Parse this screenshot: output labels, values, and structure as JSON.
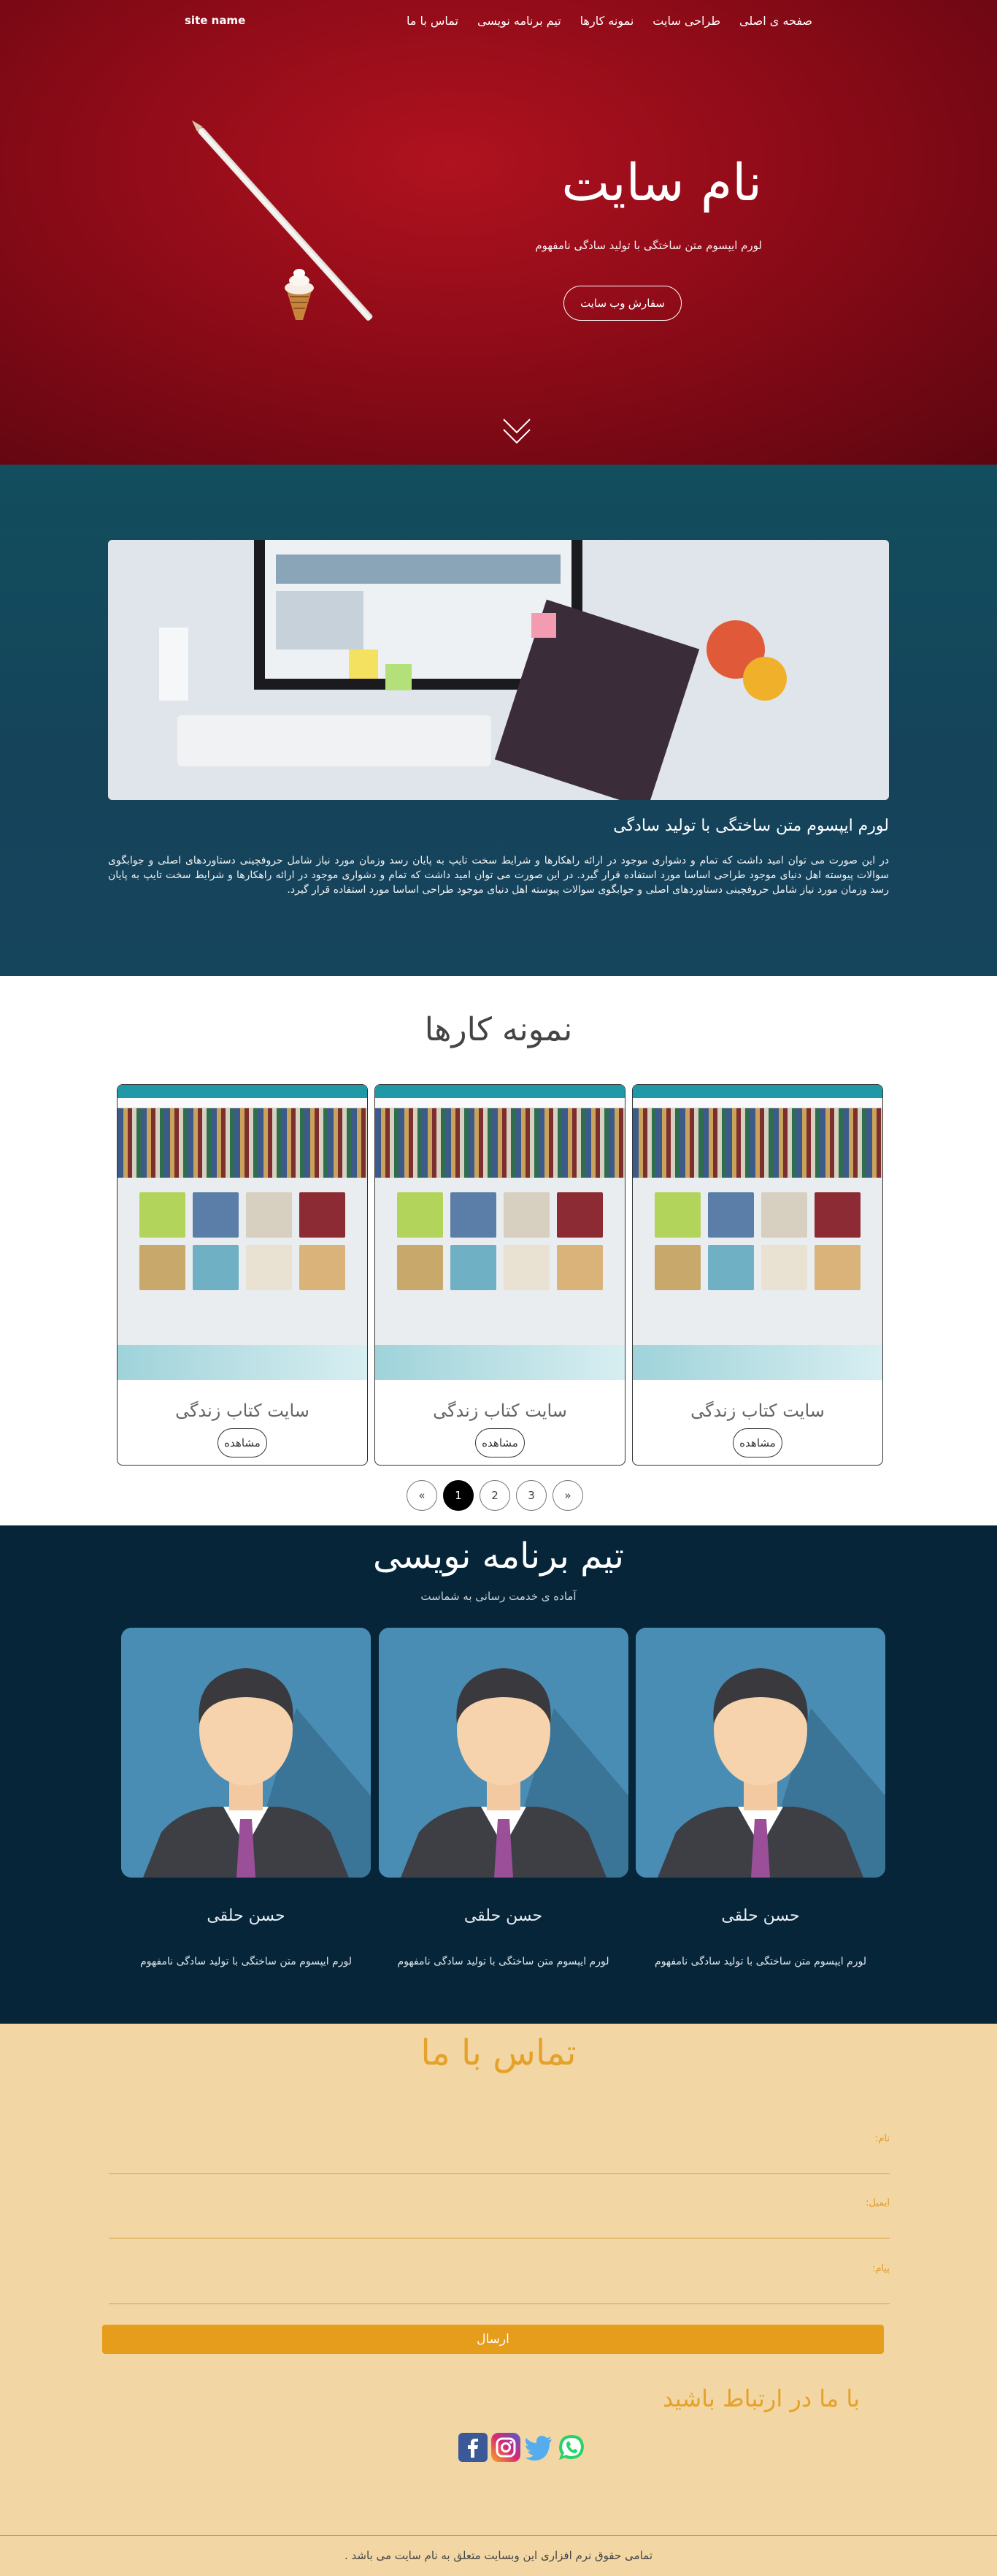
{
  "nav": {
    "brand": "site name",
    "items": [
      {
        "label": "صفحه ی اصلی"
      },
      {
        "label": "طراحی سایت"
      },
      {
        "label": "نمونه کارها"
      },
      {
        "label": "تیم برنامه نویسی"
      },
      {
        "label": "تماس با ما"
      }
    ]
  },
  "hero": {
    "title": "نام سایت",
    "subtitle": "لورم ایپسوم متن ساختگی با تولید سادگی نامفهوم",
    "cta_label": "سفارش وب سایت",
    "scroll_icon": "chevron-double-down-icon"
  },
  "about": {
    "title": "لورم ایپسوم متن ساختگی با تولید سادگی",
    "text": "در این صورت می توان امید داشت که تمام و دشواری موجود در ارائه راهکارها و شرایط سخت تایپ به پایان رسد وزمان مورد نیاز شامل حروفچینی دستاوردهای اصلی و جوابگوی سوالات پیوسته اهل دنیای موجود طراحی اساسا مورد استفاده قرار گیرد. در این صورت می توان امید داشت که تمام و دشواری موجود در ارائه راهکارها و شرایط سخت تایپ به پایان رسد وزمان مورد نیاز شامل حروفچینی دستاوردهای اصلی و جوابگوی سوالات پیوسته اهل دنیای موجود طراحی اساسا مورد استفاده قرار گیرد."
  },
  "portfolio": {
    "title": "نمونه کارها",
    "cards": [
      {
        "title": "سایت کتاب زندگی",
        "button": "مشاهده"
      },
      {
        "title": "سایت کتاب زندگی",
        "button": "مشاهده"
      },
      {
        "title": "سایت کتاب زندگی",
        "button": "مشاهده"
      }
    ],
    "pagination": {
      "prev": "«",
      "pages": [
        "1",
        "2",
        "3"
      ],
      "next": "»",
      "active": "1"
    }
  },
  "team": {
    "title": "تیم برنامه نویسی",
    "subtitle": "آماده ی خدمت رسانی به شماست",
    "members": [
      {
        "name": "حسن حلقی",
        "desc": "لورم ایپسوم متن ساختگی با تولید سادگی نامفهوم"
      },
      {
        "name": "حسن حلقی",
        "desc": "لورم ایپسوم متن ساختگی با تولید سادگی نامفهوم"
      },
      {
        "name": "حسن حلقی",
        "desc": "لورم ایپسوم متن ساختگی با تولید سادگی نامفهوم"
      }
    ]
  },
  "contact": {
    "title": "تماس با ما",
    "name_label": "نام:",
    "email_label": "ایمیل:",
    "message_label": "پیام:",
    "send_label": "ارسال",
    "keep_touch": "با ما در ارتباط باشید",
    "socials": [
      "facebook-icon",
      "instagram-icon",
      "twitter-icon",
      "whatsapp-icon"
    ]
  },
  "footer": {
    "copyright": "تمامی حقوق نرم افزاری این وبسایت متعلق به نام سایت می باشد ."
  },
  "colors": {
    "hero_red": "#9b0d1a",
    "about_teal": "#134b5c",
    "team_navy": "#062539",
    "contact_sand": "#f2d6a4",
    "accent_orange": "#e79d1c"
  }
}
